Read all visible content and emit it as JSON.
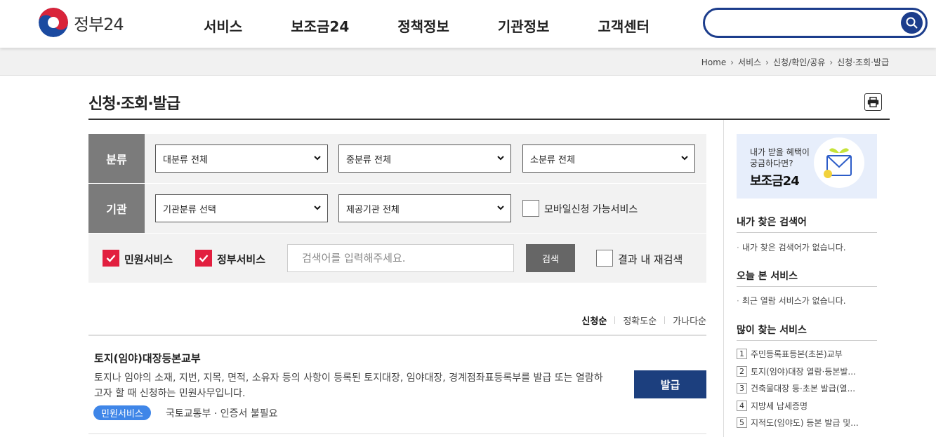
{
  "header": {
    "logo_text": "정부24",
    "nav": [
      "서비스",
      "보조금24",
      "정책정보",
      "기관정보",
      "고객센터"
    ],
    "search_value": ""
  },
  "breadcrumb": [
    "Home",
    "서비스",
    "신청/확인/공유",
    "신청·조회·발급"
  ],
  "page": {
    "title": "신청·조회·발급"
  },
  "filter": {
    "label_category": "분류",
    "label_agency": "기관",
    "select_major": "대분류 전체",
    "select_middle": "중분류 전체",
    "select_minor": "소분류 전체",
    "select_agency_type": "기관분류 선택",
    "select_provider": "제공기관 전체",
    "mobile_checkbox_label": "모바일신청 가능서비스",
    "civil_checkbox_label": "민원서비스",
    "gov_checkbox_label": "정부서비스",
    "keyword_placeholder": "검색어를 입력해주세요.",
    "search_button": "검색",
    "research_label": "결과 내 재검색"
  },
  "sort": [
    "신청순",
    "정확도순",
    "가나다순"
  ],
  "result": {
    "title": "토지(임야)대장등본교부",
    "description": "토지나 임야의 소재, 지번, 지목, 면적, 소유자 등의 사항이 등록된 토지대장, 임야대장, 경계점좌표등록부를 발급 또는 열람하고자 할 때 신청하는 민원사무입니다.",
    "badge": "민원서비스",
    "meta": "국토교통부 ·  인증서 불필요",
    "button": "발급"
  },
  "sidebar": {
    "banner_line1": "내가 받을 혜택이",
    "banner_line2": "궁금하다면?",
    "banner_title": "보조금24",
    "my_search_title": "내가 찾은 검색어",
    "my_search_empty": "내가 찾은 검색어가 없습니다.",
    "today_title": "오늘 본 서비스",
    "today_empty": "최근 열람 서비스가 없습니다.",
    "popular_title": "많이 찾는 서비스",
    "popular": [
      {
        "num": "1",
        "text": "주민등록표등본(초본)교부"
      },
      {
        "num": "2",
        "text": "토지(임야)대장 열람·등본발..."
      },
      {
        "num": "3",
        "text": "건축물대장 등·초본 발급(열..."
      },
      {
        "num": "4",
        "text": "지방세 납세증명"
      },
      {
        "num": "5",
        "text": "지적도(임야도) 등본 발급 및..."
      }
    ]
  },
  "colors": {
    "brand_navy": "#1c3d8c",
    "check_red": "#e21f3f",
    "badge_blue": "#3f86e8",
    "issue_button": "#1c3f7e"
  }
}
